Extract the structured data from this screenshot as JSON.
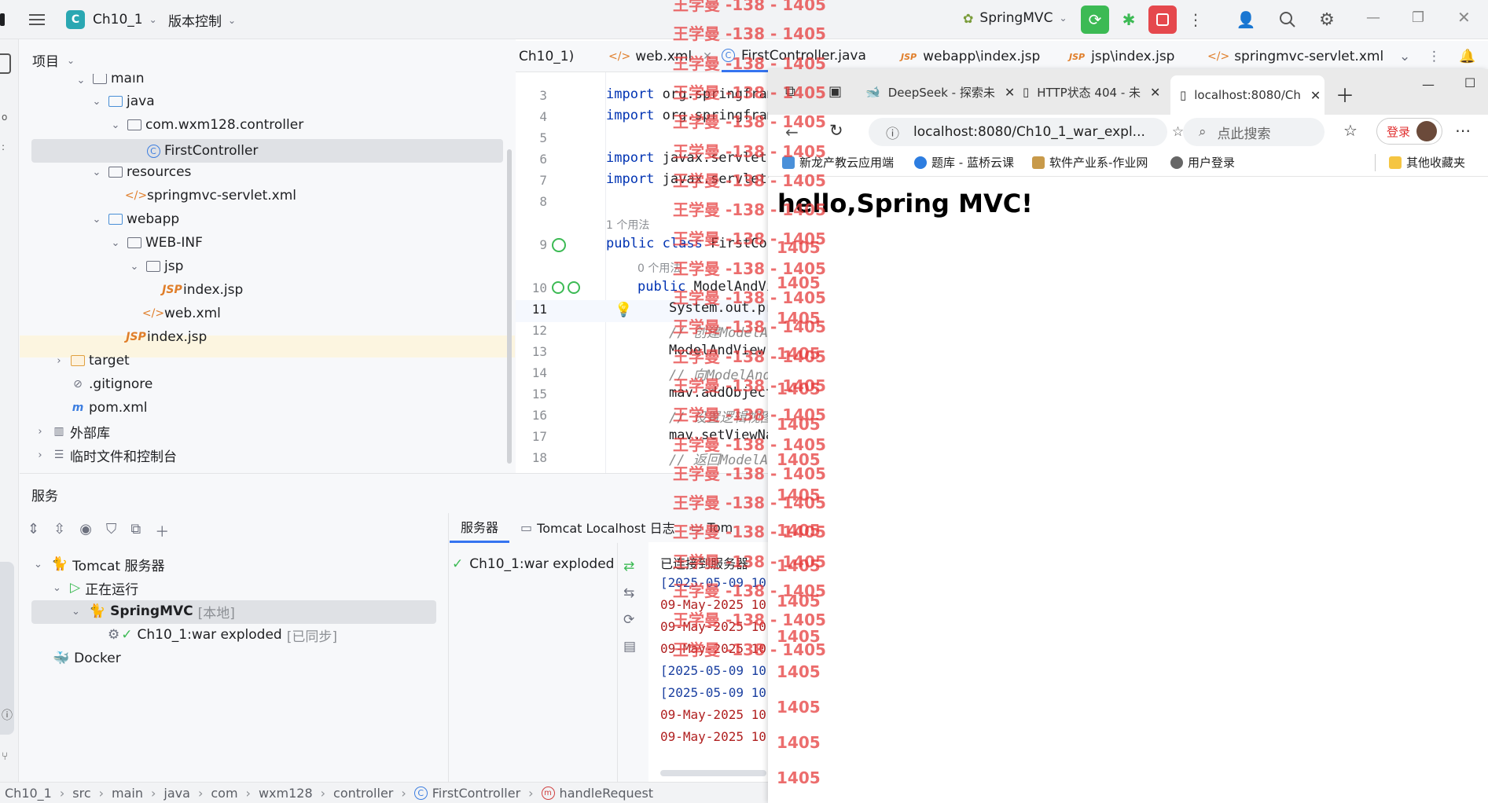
{
  "titlebar": {
    "project_badge": "C",
    "project_name": "Ch10_1",
    "vcs_label": "版本控制",
    "run_config": "SpringMVC"
  },
  "project_panel": {
    "title": "项目",
    "tree": [
      {
        "label": "main"
      },
      {
        "label": "java"
      },
      {
        "label": "com.wxm128.controller"
      },
      {
        "label": "FirstController"
      },
      {
        "label": "resources"
      },
      {
        "label": "springmvc-servlet.xml"
      },
      {
        "label": "webapp"
      },
      {
        "label": "WEB-INF"
      },
      {
        "label": "jsp"
      },
      {
        "label": "index.jsp"
      },
      {
        "label": "web.xml"
      },
      {
        "label": "index.jsp"
      },
      {
        "label": "target"
      },
      {
        "label": ".gitignore"
      },
      {
        "label": "pom.xml"
      },
      {
        "label": "外部库"
      },
      {
        "label": "临时文件和控制台"
      }
    ]
  },
  "editor": {
    "tabs": [
      {
        "label": "Ch10_1)"
      },
      {
        "label": "web.xml"
      },
      {
        "label": "FirstController.java"
      },
      {
        "label": "webapp\\index.jsp"
      },
      {
        "label": "jsp\\index.jsp"
      },
      {
        "label": "springmvc-servlet.xml"
      }
    ],
    "lines": [
      {
        "num": "3",
        "text": "import org.springfram"
      },
      {
        "num": "4",
        "text": "import org.springfram"
      },
      {
        "num": "5",
        "text": ""
      },
      {
        "num": "6",
        "text": "import javax.servlet."
      },
      {
        "num": "7",
        "text": "import javax.servlet."
      },
      {
        "num": "8",
        "text": ""
      },
      {
        "num": "9",
        "text": "public class FirstCon"
      },
      {
        "num": "10",
        "text": "public ModelAndVi"
      },
      {
        "num": "11",
        "text": "System.out.pr"
      },
      {
        "num": "12",
        "text": "// 创建ModelAn"
      },
      {
        "num": "13",
        "text": "ModelAndView"
      },
      {
        "num": "14",
        "text": "// 向ModelAnd"
      },
      {
        "num": "15",
        "text": "mav.addObject"
      },
      {
        "num": "16",
        "text": "// 设置逻辑视图"
      },
      {
        "num": "17",
        "text": "mav.setViewNa"
      },
      {
        "num": "18",
        "text": "// 返回ModelAn"
      }
    ],
    "usage_hint_1": "1 个用法",
    "usage_hint_0": "0 个用法"
  },
  "services": {
    "title": "服务",
    "tree": [
      {
        "label": "Tomcat 服务器"
      },
      {
        "label": "正在运行"
      },
      {
        "label": "SpringMVC",
        "tag": "[本地]"
      },
      {
        "label": "Ch10_1:war exploded",
        "tag": "[已同步]"
      },
      {
        "label": "Docker"
      }
    ],
    "tabs": [
      "服务器",
      "Tomcat Localhost 日志",
      "Tom"
    ],
    "deploy_item": "Ch10_1:war exploded",
    "console_lines": [
      "已连接到服务器",
      "[2025-05-09 10",
      "09-May-2025 10",
      "09-May-2025 10",
      "09-May-2025 10",
      "[2025-05-09 10",
      "[2025-05-09 10",
      "09-May-2025 10",
      "09-May-2025 10"
    ]
  },
  "statusbar": {
    "breadcrumb": [
      "Ch10_1",
      "src",
      "main",
      "java",
      "com",
      "wxm128",
      "controller",
      "FirstController",
      "handleRequest"
    ]
  },
  "browser": {
    "tabs": [
      {
        "label": "DeepSeek - 探索未"
      },
      {
        "label": "HTTP状态 404 - 未"
      },
      {
        "label": "localhost:8080/Ch"
      }
    ],
    "address": "localhost:8080/Ch10_1_war_expl...",
    "search_placeholder": "点此搜索",
    "login_label": "登录",
    "bookmarks": [
      {
        "label": "新龙产教云应用端"
      },
      {
        "label": "题库 - 蓝桥云课"
      },
      {
        "label": "软件产业系-作业网"
      },
      {
        "label": "用户登录"
      },
      {
        "label": "其他收藏夹"
      }
    ],
    "page_heading": "hello,Spring MVC!"
  },
  "watermark": {
    "text": "王学曼 -138 - 1405",
    "short": "1405"
  },
  "colors": {
    "accent": "#3574f0",
    "run_green": "#3cba54",
    "stop_red": "#e5484d",
    "watermark": "#e63c3c"
  }
}
